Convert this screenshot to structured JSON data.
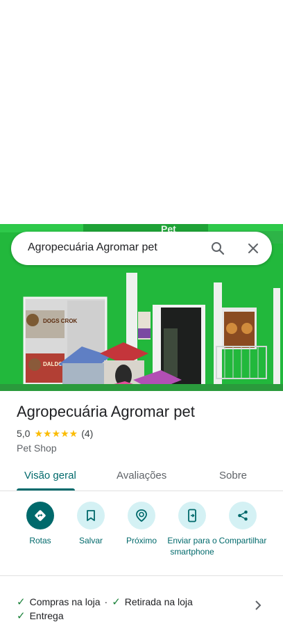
{
  "search": {
    "query": "Agropecuária Agromar pet"
  },
  "place": {
    "name": "Agropecuária Agromar pet",
    "rating": "5,0",
    "stars": "★★★★★",
    "review_count": "(4)",
    "category": "Pet Shop"
  },
  "photo": {
    "sign_text": "Pet",
    "poster_1": "DOGS CROK",
    "poster_2": "DALDOG"
  },
  "tabs": [
    {
      "label": "Visão geral"
    },
    {
      "label": "Avaliações"
    },
    {
      "label": "Sobre"
    }
  ],
  "actions": [
    {
      "label": "Rotas",
      "icon": "directions-icon"
    },
    {
      "label": "Salvar",
      "icon": "bookmark-icon"
    },
    {
      "label": "Próximo",
      "icon": "nearby-icon"
    },
    {
      "label": "Enviar para o smartphone",
      "icon": "send-to-phone-icon"
    },
    {
      "label": "Compartilhar",
      "icon": "share-icon"
    }
  ],
  "amenities": {
    "items": [
      "Compras na loja",
      "Retirada na loja",
      "Entrega"
    ],
    "separator": "·"
  },
  "colors": {
    "accent": "#00696b",
    "accent_light": "#d4f1f4",
    "star": "#fbbc04",
    "check": "#188038"
  }
}
